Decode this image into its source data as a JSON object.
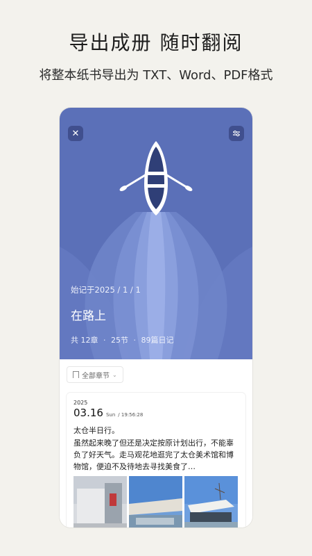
{
  "header": {
    "headline": "导出成册  随时翻阅",
    "subheadline": "将整本纸书导出为 TXT、Word、PDF格式"
  },
  "book": {
    "close_icon": "close-icon",
    "settings_icon": "sliders-icon",
    "start_date": "始记于2025 / 1 / 1",
    "title": "在路上",
    "stats": {
      "chapters": "共 12章",
      "sections": "25节",
      "entries": "89篇日记",
      "separator": "·"
    },
    "colors": {
      "hero": "#5b70b8",
      "wake_light": "#9fb2ea"
    }
  },
  "chapter_filter": {
    "label": "全部章节",
    "icon": "bookmark-icon"
  },
  "entry": {
    "year": "2025",
    "date": "03.16",
    "weekday": "Sun",
    "time": "/ 19:56:28",
    "title": "太仓半日行。",
    "body": "虽然起来晚了但还是决定按原计划出行，不能辜负了好天气。走马观花地逛完了太仓美术馆和博物馆，便迫不及待地去寻找美食了…"
  }
}
